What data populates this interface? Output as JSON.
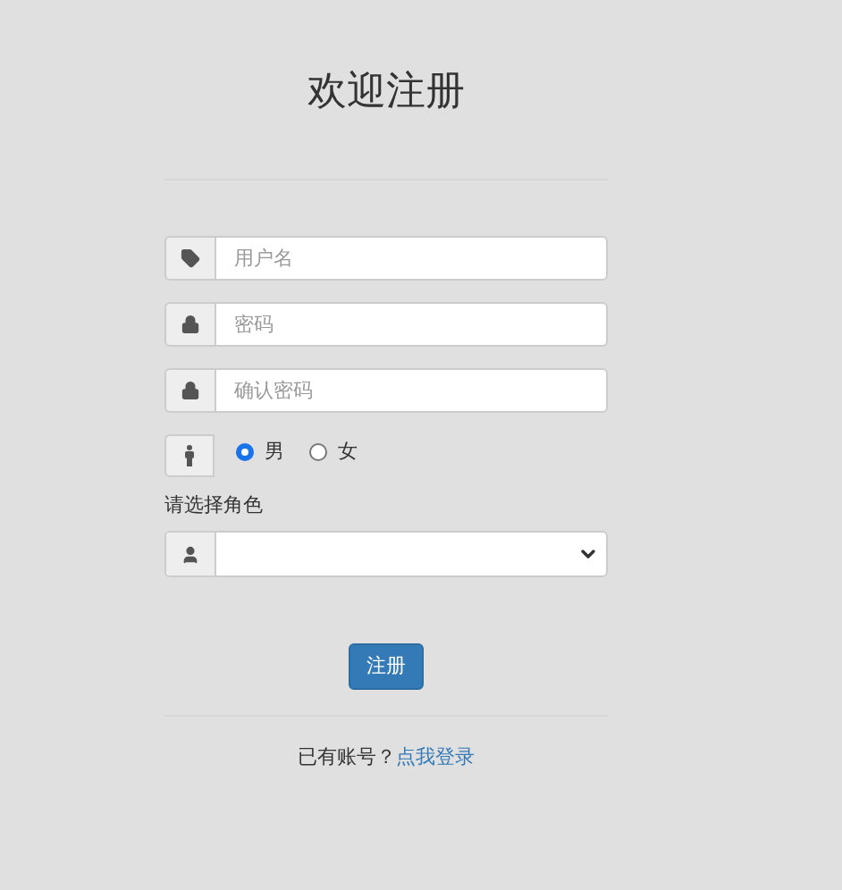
{
  "title": "欢迎注册",
  "fields": [
    {
      "kind": "text",
      "placeholder": "用户名"
    },
    {
      "kind": "password",
      "placeholder": "密码"
    },
    {
      "kind": "password",
      "placeholder": "确认密码"
    }
  ],
  "gender": {
    "options": [
      {
        "label": "男",
        "selected": true
      },
      {
        "label": "女",
        "selected": false
      }
    ]
  },
  "role": {
    "label": "请选择角色"
  },
  "submit": "注册",
  "footer": {
    "text": "已有账号？",
    "link": "点我登录"
  }
}
